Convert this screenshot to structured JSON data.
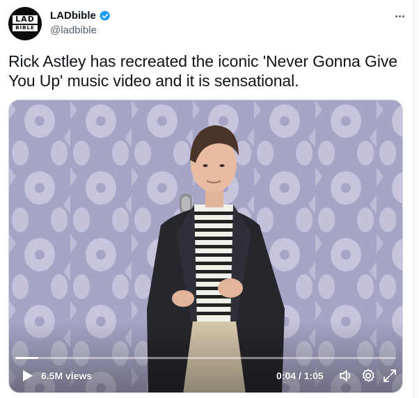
{
  "account": {
    "display_name": "LADbible",
    "handle": "@ladbible",
    "avatar_text_top": "LAD",
    "avatar_text_bottom": "BIBLE",
    "verified_color": "#1d9bf0"
  },
  "tweet": {
    "text": "Rick Astley has recreated the iconic 'Never Gonna Give You Up' music video and it is sensational."
  },
  "video": {
    "views": "6.5M views",
    "time": "0:04 / 1:05",
    "progress": 0.06,
    "icons": [
      "play-icon",
      "volume-icon",
      "settings-icon",
      "fullscreen-icon"
    ]
  },
  "colors": {
    "text": "#0f1419",
    "secondary": "#536471",
    "backdrop": "#a9a7c8"
  }
}
